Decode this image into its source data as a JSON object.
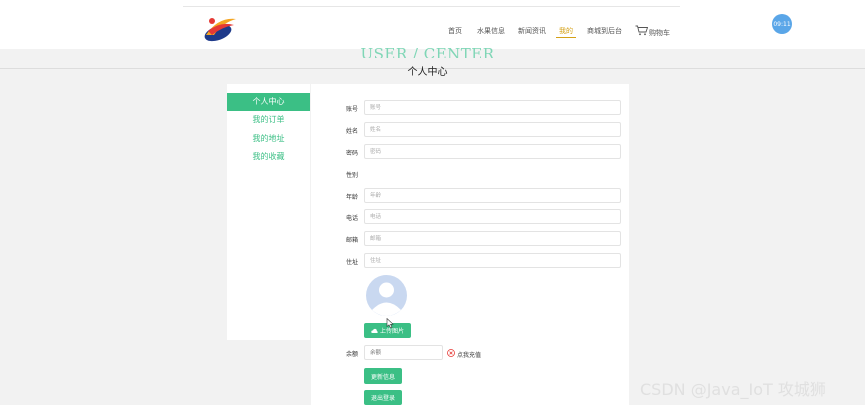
{
  "nav": {
    "items": [
      {
        "label": "首页",
        "active": false
      },
      {
        "label": "水果信息",
        "active": false
      },
      {
        "label": "新闻资讯",
        "active": false
      },
      {
        "label": "我的",
        "active": true
      },
      {
        "label": "商城到后台",
        "active": false
      },
      {
        "label": "购物车",
        "active": false
      }
    ],
    "time_badge": "09:11",
    "accent_color": "#d4a017"
  },
  "page_header": {
    "en_title": "USER / CENTER",
    "cn_title": "个人中心"
  },
  "sidebar": {
    "items": [
      {
        "label": "个人中心",
        "active": true
      },
      {
        "label": "我的订单",
        "active": false
      },
      {
        "label": "我的地址",
        "active": false
      },
      {
        "label": "我的收藏",
        "active": false
      }
    ],
    "accent_color": "#3bbf85"
  },
  "form": {
    "fields": [
      {
        "label": "账号",
        "placeholder": "账号"
      },
      {
        "label": "姓名",
        "placeholder": "姓名"
      },
      {
        "label": "密码",
        "placeholder": "密码"
      },
      {
        "label": "性别",
        "placeholder": ""
      },
      {
        "label": "年龄",
        "placeholder": "年龄"
      },
      {
        "label": "电话",
        "placeholder": "电话"
      },
      {
        "label": "邮箱",
        "placeholder": "邮箱"
      },
      {
        "label": "住址",
        "placeholder": "住址"
      }
    ],
    "upload_button": "上传图片",
    "balance_label": "余额",
    "balance_placeholder": "余额",
    "recharge_label": "点我充值",
    "update_button": "更新信息",
    "logout_button": "退出登录"
  },
  "watermark": "CSDN @Java_IoT 攻城狮",
  "icons": {
    "logo": "brand-logo",
    "cart": "cart-icon",
    "avatar": "default-avatar-icon",
    "upload": "cloud-upload-icon",
    "recharge": "close-circle-icon",
    "cursor": "mouse-cursor-icon"
  }
}
